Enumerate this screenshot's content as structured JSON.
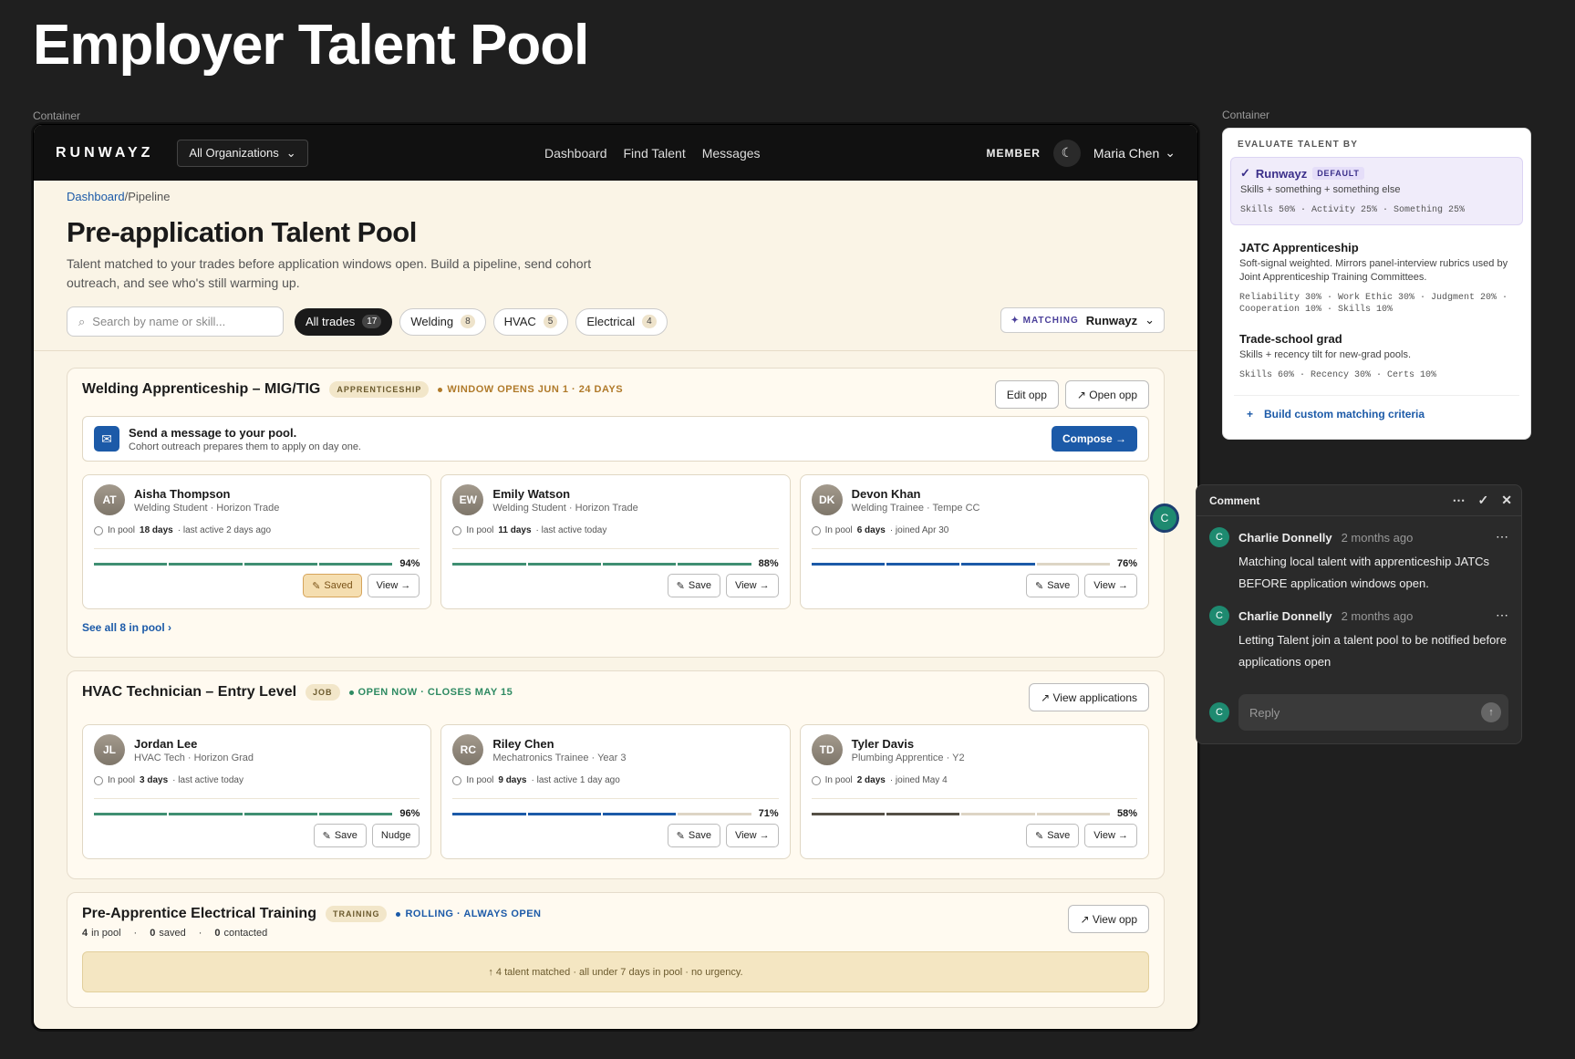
{
  "page_title": "Employer Talent Pool",
  "frame_labels": {
    "left": "Container",
    "right": "Container"
  },
  "nav": {
    "brand": "RUNWAYZ",
    "org": "All Organizations",
    "links": [
      "Dashboard",
      "Find Talent",
      "Messages"
    ],
    "member": "MEMBER",
    "user": "Maria Chen"
  },
  "breadcrumb": {
    "root": "Dashboard",
    "current": "Pipeline"
  },
  "header": {
    "title": "Pre-application Talent Pool",
    "subtitle": "Talent matched to your trades before application windows open. Build a pipeline, send cohort outreach, and see who's still warming up."
  },
  "search": {
    "placeholder": "Search by name or skill..."
  },
  "filters": [
    {
      "label": "All trades",
      "count": "17"
    },
    {
      "label": "Welding",
      "count": "8"
    },
    {
      "label": "HVAC",
      "count": "5"
    },
    {
      "label": "Electrical",
      "count": "4"
    }
  ],
  "matching": {
    "label": "✦ MATCHING",
    "value": "Runwayz"
  },
  "opp1": {
    "title": "Welding Apprenticeship – MIG/TIG",
    "tag": "APPRENTICESHIP",
    "status": "WINDOW OPENS JUN 1 · 24 DAYS",
    "status_color": "#b07a2a",
    "edit": "Edit opp",
    "open": "↗ Open opp",
    "msg_title": "Send a message to your pool.",
    "msg_sub": "Cohort outreach prepares them to apply on day one.",
    "compose": "Compose →",
    "see_all": "See all 8 in pool ›",
    "candidates": [
      {
        "initials": "AT",
        "name": "Aisha Thompson",
        "role": "Welding Student · Horizon Trade",
        "days": "18 days",
        "activity": "· last active 2 days ago",
        "pct": "94%",
        "score": 0.94,
        "color": "#3f8f72",
        "b1": "Saved",
        "b2": "View →"
      },
      {
        "initials": "EW",
        "name": "Emily Watson",
        "role": "Welding Student · Horizon Trade",
        "days": "11 days",
        "activity": "· last active today",
        "pct": "88%",
        "score": 0.88,
        "color": "#3f8f72",
        "b1": "Save",
        "b2": "View →"
      },
      {
        "initials": "DK",
        "name": "Devon Khan",
        "role": "Welding Trainee · Tempe CC",
        "days": "6 days",
        "activity": "· joined Apr 30",
        "pct": "76%",
        "score": 0.76,
        "color": "#1c5aa8",
        "b1": "Save",
        "b2": "View →"
      }
    ]
  },
  "opp2": {
    "title": "HVAC Technician – Entry Level",
    "tag": "JOB",
    "status": "OPEN NOW · CLOSES MAY 15",
    "status_color": "#2e8a62",
    "view_apps": "↗ View applications",
    "candidates": [
      {
        "initials": "JL",
        "name": "Jordan Lee",
        "role": "HVAC Tech · Horizon Grad",
        "days": "3 days",
        "activity": "· last active today",
        "pct": "96%",
        "score": 0.96,
        "color": "#3f8f72",
        "b1": "Save",
        "b2": "Nudge"
      },
      {
        "initials": "RC",
        "name": "Riley Chen",
        "role": "Mechatronics Trainee · Year 3",
        "days": "9 days",
        "activity": "· last active 1 day ago",
        "pct": "71%",
        "score": 0.71,
        "color": "#1c5aa8",
        "b1": "Save",
        "b2": "View →"
      },
      {
        "initials": "TD",
        "name": "Tyler Davis",
        "role": "Plumbing Apprentice · Y2",
        "days": "2 days",
        "activity": "· joined May 4",
        "pct": "58%",
        "score": 0.58,
        "color": "#555046",
        "b1": "Save",
        "b2": "View →"
      }
    ]
  },
  "opp3": {
    "title": "Pre-Apprentice Electrical Training",
    "tag": "TRAINING",
    "status": "ROLLING · ALWAYS OPEN",
    "status_color": "#1c5aa8",
    "view": "↗ View opp",
    "pool": "4",
    "pool_label": "in pool",
    "saved": "0",
    "saved_label": "saved",
    "contacted": "0",
    "contacted_label": "contacted",
    "note": "↑ 4 talent matched · all under 7 days in pool · no urgency."
  },
  "in_pool_label": "In pool",
  "evaluate": {
    "title": "EVALUATE TALENT BY",
    "options": [
      {
        "name": "Runwayz",
        "badge": "DEFAULT",
        "desc": "Skills + something + something else",
        "weights": "Skills 50% · Activity 25% · Something 25%"
      },
      {
        "name": "JATC Apprenticeship",
        "desc": "Soft-signal weighted. Mirrors panel-interview rubrics used by Joint Apprenticeship Training Committees.",
        "weights": "Reliability 30% · Work Ethic 30% · Judgment 20% · Cooperation 10% · Skills 10%"
      },
      {
        "name": "Trade-school grad",
        "desc": "Skills + recency tilt for new-grad pools.",
        "weights": "Skills 60% · Recency 30% · Certs 10%"
      }
    ],
    "build": "Build custom matching criteria"
  },
  "comment": {
    "title": "Comment",
    "items": [
      {
        "author": "Charlie Donnelly",
        "time": "2 months ago",
        "text": "Matching local talent with apprenticeship JATCs BEFORE application windows open."
      },
      {
        "author": "Charlie Donnelly",
        "time": "2 months ago",
        "text": "Letting Talent join a talent pool to be notified before applications open"
      }
    ],
    "reply_placeholder": "Reply",
    "avatar": "C"
  }
}
